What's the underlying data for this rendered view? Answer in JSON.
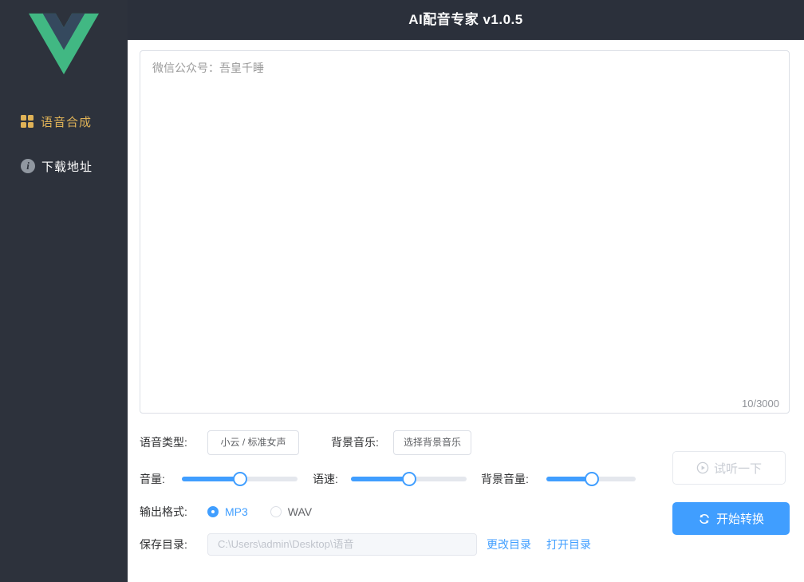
{
  "header": {
    "title": "AI配音专家 v1.0.5"
  },
  "sidebar": {
    "items": [
      {
        "label": "语音合成",
        "icon": "grid-menu-icon",
        "active": true
      },
      {
        "label": "下载地址",
        "icon": "info-icon",
        "active": false
      }
    ]
  },
  "editor": {
    "text": "微信公众号：吾皇千睡",
    "counter": "10/3000"
  },
  "controls": {
    "voice_type_label": "语音类型:",
    "voice_type_value": "小云 / 标准女声",
    "bgm_label": "背景音乐:",
    "bgm_button": "选择背景音乐",
    "volume_label": "音量:",
    "volume_percent": 50,
    "speed_label": "语速:",
    "speed_percent": 50,
    "bg_volume_label": "背景音量:",
    "bg_volume_percent": 51,
    "format_label": "输出格式:",
    "format_options": [
      {
        "label": "MP3",
        "selected": true
      },
      {
        "label": "WAV",
        "selected": false
      }
    ],
    "save_dir_label": "保存目录:",
    "save_dir_value": "C:\\Users\\admin\\Desktop\\语音",
    "change_dir_link": "更改目录",
    "open_dir_link": "打开目录"
  },
  "actions": {
    "preview_button": "试听一下",
    "convert_button": "开始转换"
  },
  "colors": {
    "accent": "#409EFF",
    "active_menu_gold": "#e0b357",
    "sidebar_bg": "#2d323c",
    "header_bg": "#2b303b"
  }
}
